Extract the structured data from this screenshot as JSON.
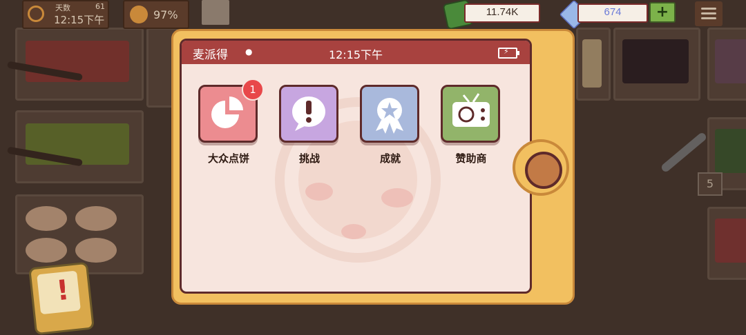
{
  "hud": {
    "day_label": "天数",
    "day_value": "61",
    "time": "12:15下午",
    "mood_percent": "97%",
    "money": "11.74K",
    "gems": "674",
    "add_label": "+"
  },
  "tablet": {
    "carrier": "麦派得",
    "clock": "12:15下午",
    "apps": [
      {
        "label": "大众点饼",
        "badge": "1",
        "color": "#ec8c90",
        "icon": "pie-chart-icon"
      },
      {
        "label": "挑战",
        "color": "#c7a6e0",
        "icon": "exclamation-bubble-icon"
      },
      {
        "label": "成就",
        "color": "#a9b9dc",
        "icon": "medal-icon"
      },
      {
        "label": "赞助商",
        "color": "#92b46a",
        "icon": "tv-icon"
      }
    ]
  },
  "tongs_count": "5",
  "colors": {
    "tablet_frame": "#f2c060",
    "status_bar": "#a8423f",
    "screen_bg": "#f7e5de",
    "badge": "#e8484a"
  }
}
